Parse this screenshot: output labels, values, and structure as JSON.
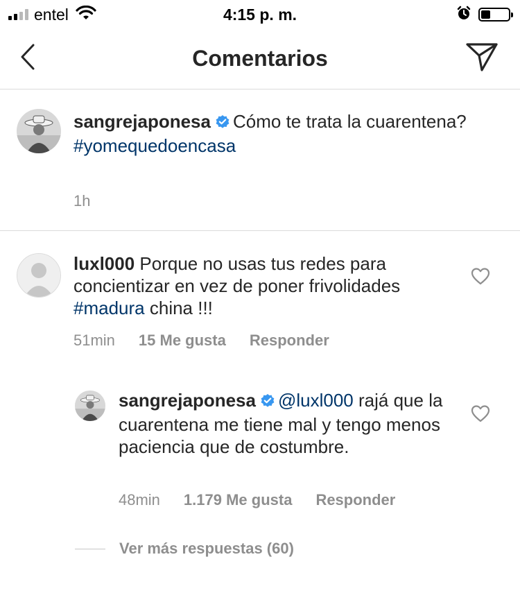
{
  "status_bar": {
    "carrier": "entel",
    "time": "4:15 p. m.",
    "battery_level": 0.35
  },
  "nav": {
    "title": "Comentarios"
  },
  "caption": {
    "username": "sangrejaponesa",
    "text": "Cómo te trata la cuarentena?",
    "hashtag": "#yomequedoencasa",
    "time": "1h"
  },
  "comment": {
    "username": "luxl000",
    "text_before": "Porque no usas tus redes para concientizar en vez de poner frivolidades",
    "hashtag": "#madura",
    "text_after": "china !!!",
    "time": "51min",
    "likes": "15 Me gusta",
    "reply_label": "Responder"
  },
  "reply": {
    "username": "sangrejaponesa",
    "mention": "@luxl000",
    "text": "rajá que la cuarentena me tiene mal y tengo menos paciencia que de costumbre.",
    "time": "48min",
    "likes": "1.179 Me gusta",
    "reply_label": "Responder"
  },
  "view_more": {
    "label": "Ver más respuestas (60)"
  },
  "colors": {
    "hashtag": "#003569",
    "verified": "#3897f0",
    "secondary_text": "#8e8e8e",
    "divider": "#dbdbdb"
  },
  "icons": {
    "back": "chevron-left-icon",
    "send": "paper-plane-icon",
    "like": "heart-outline-icon",
    "verified": "verified-badge-icon",
    "alarm": "alarm-icon",
    "wifi": "wifi-icon"
  }
}
